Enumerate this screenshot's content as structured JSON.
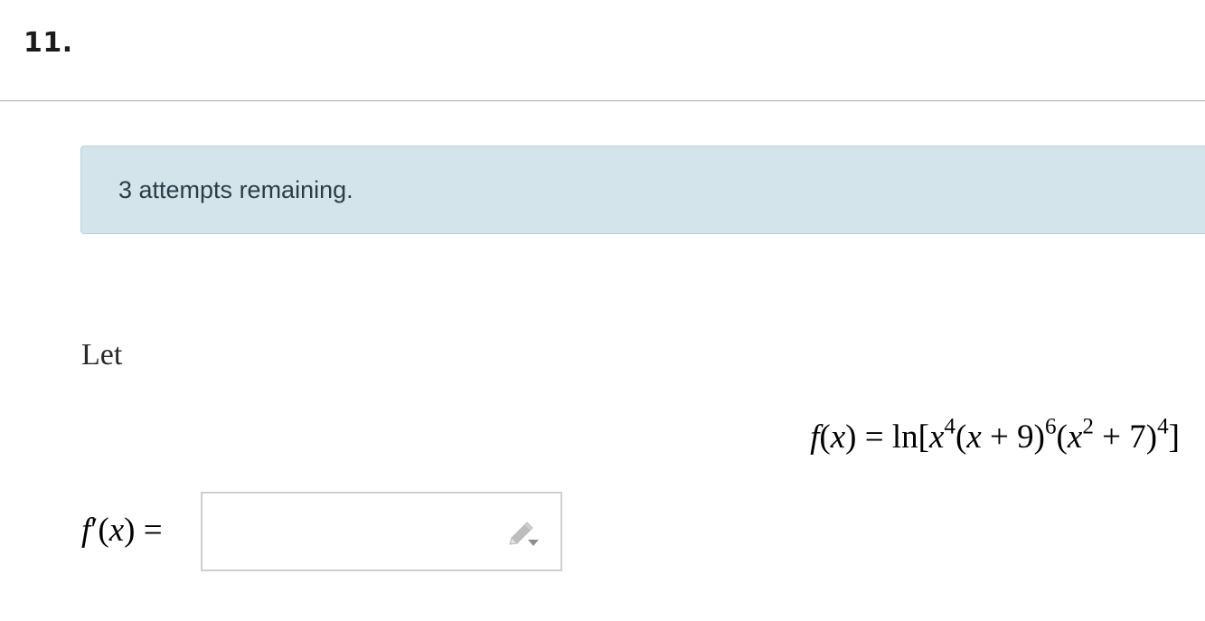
{
  "question": {
    "number": "11."
  },
  "alert": {
    "text": "3 attempts remaining."
  },
  "prompt": {
    "intro": "Let"
  },
  "equation": {
    "lhs_f": "f",
    "lhs_x": "x",
    "ln": "ln",
    "var": "x",
    "exp1": "4",
    "const1": "9",
    "exp2": "6",
    "exp3": "2",
    "const2": "7",
    "exp4": "4"
  },
  "answer": {
    "label_f": "f",
    "label_x": "x",
    "value": "",
    "placeholder": "",
    "edit_icon": "pencil-dropdown-icon"
  }
}
